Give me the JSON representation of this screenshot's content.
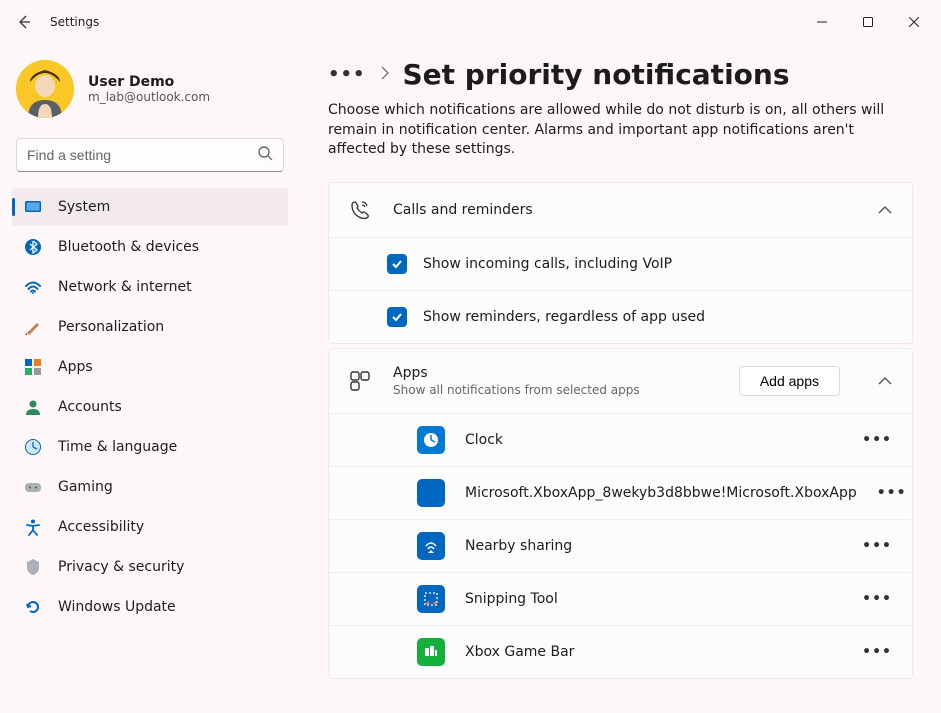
{
  "window": {
    "title": "Settings"
  },
  "user": {
    "name": "User Demo",
    "email": "m_lab@outlook.com"
  },
  "search": {
    "placeholder": "Find a setting"
  },
  "nav": [
    {
      "id": "system",
      "label": "System",
      "active": true
    },
    {
      "id": "bluetooth",
      "label": "Bluetooth & devices"
    },
    {
      "id": "network",
      "label": "Network & internet"
    },
    {
      "id": "personalization",
      "label": "Personalization"
    },
    {
      "id": "apps",
      "label": "Apps"
    },
    {
      "id": "accounts",
      "label": "Accounts"
    },
    {
      "id": "time",
      "label": "Time & language"
    },
    {
      "id": "gaming",
      "label": "Gaming"
    },
    {
      "id": "accessibility",
      "label": "Accessibility"
    },
    {
      "id": "privacy",
      "label": "Privacy & security"
    },
    {
      "id": "update",
      "label": "Windows Update"
    }
  ],
  "page": {
    "title": "Set priority notifications",
    "description": "Choose which notifications are allowed while do not disturb is on, all others will remain in notification center. Alarms and important app notifications aren't affected by these settings."
  },
  "calls_section": {
    "title": "Calls and reminders",
    "check1": "Show incoming calls, including VoIP",
    "check2": "Show reminders, regardless of app used"
  },
  "apps_section": {
    "title": "Apps",
    "subtitle": "Show all notifications from selected apps",
    "add_button": "Add apps",
    "items": [
      {
        "label": "Clock",
        "bg": "#0078d4"
      },
      {
        "label": "Microsoft.XboxApp_8wekyb3d8bbwe!Microsoft.XboxApp",
        "bg": "#0067c0"
      },
      {
        "label": "Nearby sharing",
        "bg": "#0067c0"
      },
      {
        "label": "Snipping Tool",
        "bg": "#0067c0"
      },
      {
        "label": "Xbox Game Bar",
        "bg": "#14b03a"
      }
    ]
  }
}
